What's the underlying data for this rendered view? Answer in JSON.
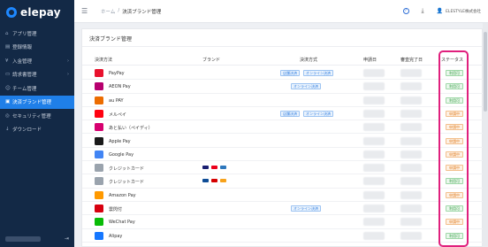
{
  "app": {
    "name": "elepay"
  },
  "sidebar": {
    "items": [
      {
        "icon": "⌂",
        "label": "アプリ管理",
        "chevron": ""
      },
      {
        "icon": "▤",
        "label": "登録情報",
        "chevron": ""
      },
      {
        "icon": "¥",
        "label": "入金管理",
        "chevron": "›"
      },
      {
        "icon": "▭",
        "label": "請求書管理",
        "chevron": "›"
      },
      {
        "icon": "☺",
        "label": "チーム管理",
        "chevron": ""
      },
      {
        "icon": "▣",
        "label": "決済ブランド管理",
        "chevron": ""
      },
      {
        "icon": "◎",
        "label": "セキュリティ管理",
        "chevron": ""
      },
      {
        "icon": "↓",
        "label": "ダウンロード",
        "chevron": ""
      }
    ],
    "footer_arrow": "⇥"
  },
  "topbar": {
    "breadcrumbs": [
      "ホーム",
      "/",
      "決済ブランド管理"
    ],
    "help": "?",
    "download": "⤓",
    "user_icon": "👤",
    "user_name": "ELESTYLE株式会社"
  },
  "page": {
    "title": "決済ブランド管理",
    "columns": {
      "method": "決済方法",
      "brand": "ブランド",
      "payment_type": "決済方式",
      "apply_date": "申請日",
      "review_date": "審査完了日",
      "status": "ステータス"
    }
  },
  "rows": [
    {
      "name": "PayPay",
      "logo_color": "#e8112d",
      "types": [
        "店舗決済",
        "オンライン決済"
      ],
      "status": "利用可",
      "status_kind": "ok",
      "brands": []
    },
    {
      "name": "AEON Pay",
      "logo_color": "#b6006e",
      "types": [
        "オンライン決済"
      ],
      "status": "利用可",
      "status_kind": "ok",
      "brands": []
    },
    {
      "name": "au PAY",
      "logo_color": "#ec6c00",
      "types": [],
      "status": "利用可",
      "status_kind": "ok",
      "brands": []
    },
    {
      "name": "メルペイ",
      "logo_color": "#ff0211",
      "types": [
        "店舗決済",
        "オンライン決済"
      ],
      "status": "申請中",
      "status_kind": "ng",
      "brands": []
    },
    {
      "name": "あと払い（ペイディ）",
      "logo_color": "#d6006f",
      "types": [],
      "status": "申請中",
      "status_kind": "ng",
      "brands": []
    },
    {
      "name": "Apple Pay",
      "logo_color": "#1a1a1a",
      "types": [],
      "status": "申請中",
      "status_kind": "ng",
      "brands": []
    },
    {
      "name": "Google Pay",
      "logo_color": "#4285f4",
      "types": [],
      "status": "申請中",
      "status_kind": "ng",
      "brands": []
    },
    {
      "name": "クレジットカード",
      "logo_color": "#9aa3ad",
      "types": [],
      "status": "申請中",
      "status_kind": "ng",
      "brands": [
        "#1a1f71",
        "#eb001b",
        "#2e77bc"
      ]
    },
    {
      "name": "クレジットカード",
      "logo_color": "#9aa3ad",
      "types": [],
      "status": "利用可",
      "status_kind": "ok",
      "brands": [
        "#0e4c96",
        "#d50000",
        "#f7a21b"
      ]
    },
    {
      "name": "Amazon Pay",
      "logo_color": "#ff9900",
      "types": [],
      "status": "申請中",
      "status_kind": "ng",
      "brands": []
    },
    {
      "name": "雲閃付",
      "logo_color": "#d7000f",
      "types": [
        "オンライン決済"
      ],
      "status": "利用可",
      "status_kind": "ok",
      "brands": []
    },
    {
      "name": "WeChat Pay",
      "logo_color": "#09bb07",
      "types": [],
      "status": "申請中",
      "status_kind": "ng",
      "brands": []
    },
    {
      "name": "Alipay",
      "logo_color": "#1677ff",
      "types": [],
      "status": "利用可",
      "status_kind": "ok",
      "brands": []
    }
  ]
}
